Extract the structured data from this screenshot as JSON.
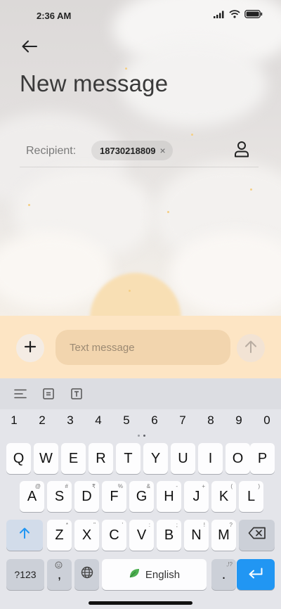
{
  "status_bar": {
    "time": "2:36 AM",
    "battery_icon": "battery-icon",
    "wifi_icon": "wifi-icon",
    "signal_icon": "signal-icon"
  },
  "header": {
    "back_icon": "back-arrow-icon",
    "title": "New message"
  },
  "recipient": {
    "label": "Recipient:",
    "chip_value": "18730218809",
    "chip_remove": "×",
    "contact_icon": "contact-person-icon"
  },
  "compose": {
    "placeholder": "Text message",
    "attach_icon": "plus-icon",
    "send_icon": "send-arrow-icon"
  },
  "keyboard": {
    "toolbar_icons": [
      "align-icon",
      "clipboard-icon",
      "text-format-icon"
    ],
    "numbers": [
      "1",
      "2",
      "3",
      "4",
      "5",
      "6",
      "7",
      "8",
      "9",
      "0"
    ],
    "row1": [
      "Q",
      "W",
      "E",
      "R",
      "T",
      "Y",
      "U",
      "I",
      "O",
      "P"
    ],
    "row2": [
      {
        "k": "A",
        "h": "@"
      },
      {
        "k": "S",
        "h": "#"
      },
      {
        "k": "D",
        "h": "₹"
      },
      {
        "k": "F",
        "h": "%"
      },
      {
        "k": "G",
        "h": "&"
      },
      {
        "k": "H",
        "h": "-"
      },
      {
        "k": "J",
        "h": "+"
      },
      {
        "k": "K",
        "h": "("
      },
      {
        "k": "L",
        "h": ")"
      }
    ],
    "row3": [
      {
        "k": "Z",
        "h": "*"
      },
      {
        "k": "X",
        "h": "\""
      },
      {
        "k": "C",
        "h": "'"
      },
      {
        "k": "V",
        "h": ":"
      },
      {
        "k": "B",
        "h": ";"
      },
      {
        "k": "N",
        "h": "!"
      },
      {
        "k": "M",
        "h": "?"
      }
    ],
    "symbols_label": "?123",
    "comma_label": ",",
    "space_label": "English",
    "period_label": ".",
    "period_hint": ",!?",
    "shift_icon": "shift-arrow-icon",
    "backspace_icon": "backspace-icon",
    "enter_icon": "enter-icon",
    "globe_icon": "globe-icon",
    "emoji_icon": "emoji-icon"
  },
  "colors": {
    "accent": "#2196f3",
    "compose_bg": "#fde5c4",
    "field_bg": "#f2d5ae"
  }
}
